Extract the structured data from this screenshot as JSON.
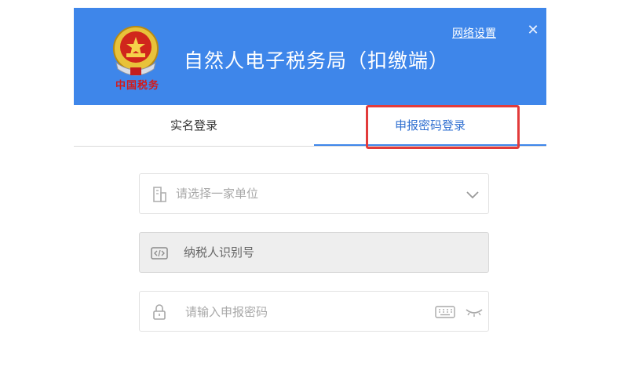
{
  "header": {
    "emblem_text": "中国税务",
    "title": "自然人电子税务局（扣缴端）",
    "network_settings": "网络设置",
    "close_symbol": "✕",
    "background_color": "#3e86ea"
  },
  "tabs": [
    {
      "label": "实名登录",
      "active": false
    },
    {
      "label": "申报密码登录",
      "active": true
    }
  ],
  "form": {
    "unit_select": {
      "placeholder": "请选择一家单位",
      "icon": "building-icon"
    },
    "taxpayer_id": {
      "placeholder": "纳税人识别号",
      "icon": "code-icon"
    },
    "password": {
      "placeholder": "请输入申报密码",
      "icon": "lock-icon"
    }
  },
  "colors": {
    "accent": "#3e86ea",
    "highlight": "#e23b3b"
  }
}
